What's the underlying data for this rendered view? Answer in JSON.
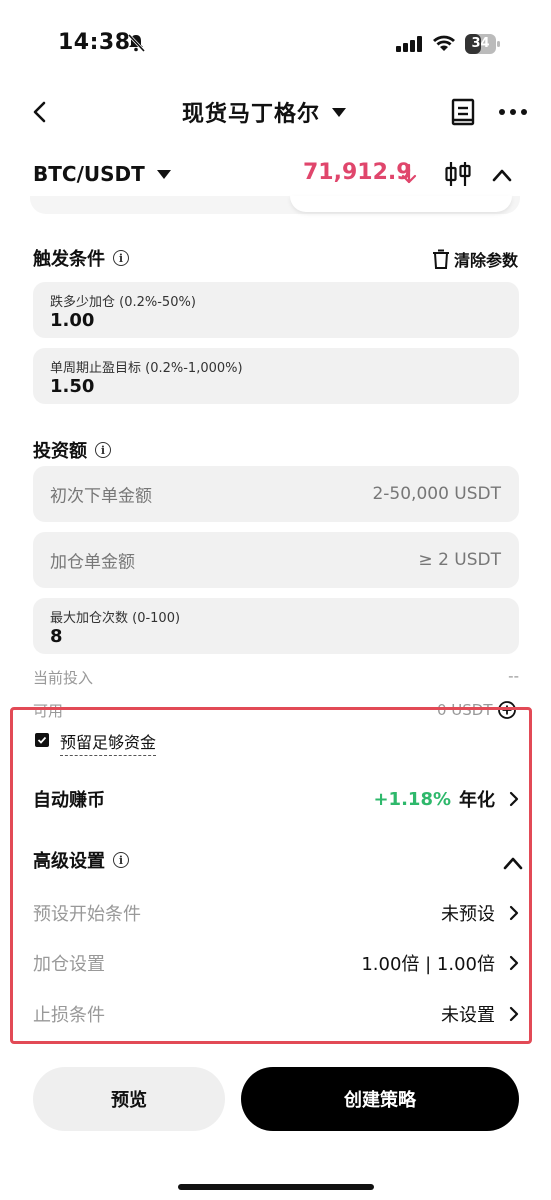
{
  "status_bar": {
    "time": "14:38",
    "battery": "34"
  },
  "header": {
    "title": "现货马丁格尔"
  },
  "pair": {
    "symbol": "BTC/USDT",
    "price": "71,912.9"
  },
  "trigger": {
    "title": "触发条件",
    "clear_label": "清除参数",
    "drop_field": {
      "label": "跌多少加仓 (0.2%-50%)",
      "value": "1.00"
    },
    "tp_field": {
      "label": "单周期止盈目标 (0.2%-1,000%)",
      "value": "1.50"
    }
  },
  "investment": {
    "title": "投资额",
    "initial_field": {
      "placeholder": "初次下单金额",
      "hint": "2-50,000 USDT"
    },
    "add_field": {
      "placeholder": "加仓单金额",
      "hint": "≥ 2 USDT"
    },
    "max_field": {
      "label": "最大加仓次数 (0-100)",
      "value": "8"
    },
    "current_label": "当前投入",
    "current_value": "--",
    "available_label": "可用",
    "available_value": "0 USDT"
  },
  "reserve": {
    "label": "预留足够资金",
    "checked": true
  },
  "auto_earn": {
    "label": "自动赚币",
    "rate": "+1.18%",
    "suffix": "年化"
  },
  "advanced": {
    "title": "高级设置",
    "rows": [
      {
        "label": "预设开始条件",
        "value": "未预设"
      },
      {
        "label": "加仓设置",
        "value": "1.00倍 | 1.00倍"
      },
      {
        "label": "止损条件",
        "value": "未设置"
      }
    ]
  },
  "buttons": {
    "preview": "预览",
    "create": "创建策略"
  },
  "colors": {
    "price_red": "#e0466c",
    "green": "#2eb86b",
    "highlight": "#e24a56"
  }
}
